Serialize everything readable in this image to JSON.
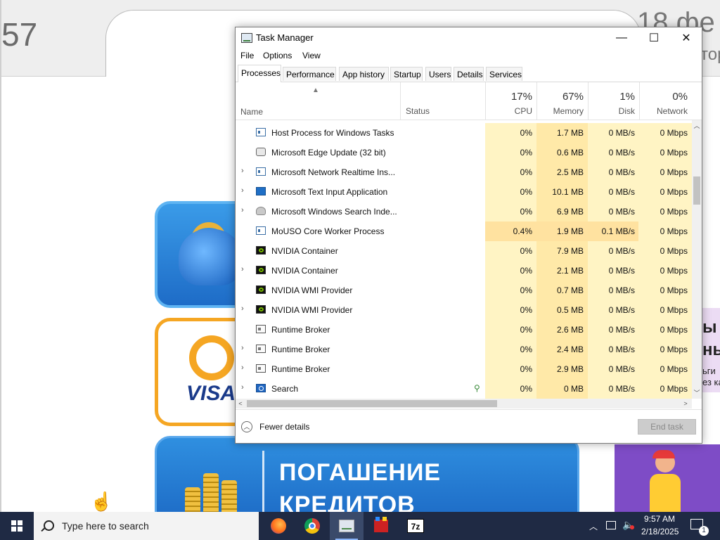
{
  "background_app": {
    "time_fragment": "57",
    "date_fragment": "18 фе",
    "date_sub_fragment": "тор",
    "credit_tile": {
      "line1": "ПОГАШЕНИЕ",
      "line2": "КРЕДИТОВ"
    },
    "qiwi_tile": {
      "card_brand": "VISA"
    },
    "promo": {
      "line1": "ы",
      "line2": "ны",
      "small1": "ьги",
      "small2": "ез ка"
    }
  },
  "window": {
    "title": "Task Manager",
    "controls": {
      "minimize": "—",
      "maximize": "☐",
      "close": "✕"
    },
    "menu": [
      "File",
      "Options",
      "View"
    ],
    "tabs": [
      "Processes",
      "Performance",
      "App history",
      "Startup",
      "Users",
      "Details",
      "Services"
    ],
    "active_tab": "Processes",
    "columns": {
      "name": "Name",
      "status": "Status",
      "cpu": {
        "percent": "17%",
        "label": "CPU"
      },
      "memory": {
        "percent": "67%",
        "label": "Memory"
      },
      "disk": {
        "percent": "1%",
        "label": "Disk"
      },
      "network": {
        "percent": "0%",
        "label": "Network"
      }
    },
    "processes": [
      {
        "name": "Host Process for Windows Tasks",
        "expandable": false,
        "icon": "host-icon",
        "status": "",
        "cpu": "0%",
        "memory": "1.7 MB",
        "disk": "0 MB/s",
        "network": "0 Mbps"
      },
      {
        "name": "Microsoft Edge Update (32 bit)",
        "expandable": false,
        "icon": "edge-update-icon",
        "status": "",
        "cpu": "0%",
        "memory": "0.6 MB",
        "disk": "0 MB/s",
        "network": "0 Mbps"
      },
      {
        "name": "Microsoft Network Realtime Ins...",
        "expandable": true,
        "icon": "host-icon",
        "status": "",
        "cpu": "0%",
        "memory": "2.5 MB",
        "disk": "0 MB/s",
        "network": "0 Mbps"
      },
      {
        "name": "Microsoft Text Input Application",
        "expandable": true,
        "icon": "text-input-icon",
        "status": "",
        "cpu": "0%",
        "memory": "10.1 MB",
        "disk": "0 MB/s",
        "network": "0 Mbps"
      },
      {
        "name": "Microsoft Windows Search Inde...",
        "expandable": true,
        "icon": "search-indexer-icon",
        "status": "",
        "cpu": "0%",
        "memory": "6.9 MB",
        "disk": "0 MB/s",
        "network": "0 Mbps"
      },
      {
        "name": "MoUSO Core Worker Process",
        "expandable": false,
        "icon": "host-icon",
        "status": "",
        "cpu": "0.4%",
        "memory": "1.9 MB",
        "disk": "0.1 MB/s",
        "network": "0 Mbps",
        "highlight": true
      },
      {
        "name": "NVIDIA Container",
        "expandable": false,
        "icon": "nvidia-icon",
        "status": "",
        "cpu": "0%",
        "memory": "7.9 MB",
        "disk": "0 MB/s",
        "network": "0 Mbps"
      },
      {
        "name": "NVIDIA Container",
        "expandable": true,
        "icon": "nvidia-icon",
        "status": "",
        "cpu": "0%",
        "memory": "2.1 MB",
        "disk": "0 MB/s",
        "network": "0 Mbps"
      },
      {
        "name": "NVIDIA WMI Provider",
        "expandable": false,
        "icon": "nvidia-icon",
        "status": "",
        "cpu": "0%",
        "memory": "0.7 MB",
        "disk": "0 MB/s",
        "network": "0 Mbps"
      },
      {
        "name": "NVIDIA WMI Provider",
        "expandable": true,
        "icon": "nvidia-icon",
        "status": "",
        "cpu": "0%",
        "memory": "0.5 MB",
        "disk": "0 MB/s",
        "network": "0 Mbps"
      },
      {
        "name": "Runtime Broker",
        "expandable": false,
        "icon": "broker-icon",
        "status": "",
        "cpu": "0%",
        "memory": "2.6 MB",
        "disk": "0 MB/s",
        "network": "0 Mbps"
      },
      {
        "name": "Runtime Broker",
        "expandable": true,
        "icon": "broker-icon",
        "status": "",
        "cpu": "0%",
        "memory": "2.4 MB",
        "disk": "0 MB/s",
        "network": "0 Mbps"
      },
      {
        "name": "Runtime Broker",
        "expandable": true,
        "icon": "broker-icon",
        "status": "",
        "cpu": "0%",
        "memory": "2.9 MB",
        "disk": "0 MB/s",
        "network": "0 Mbps"
      },
      {
        "name": "Search",
        "expandable": true,
        "icon": "search-app-icon",
        "status": "suspended-leaf",
        "cpu": "0%",
        "memory": "0 MB",
        "disk": "0 MB/s",
        "network": "0 Mbps"
      }
    ],
    "footer": {
      "fewer_details": "Fewer details",
      "end_task": "End task"
    }
  },
  "taskbar": {
    "search_placeholder": "Type here to search",
    "apps": [
      "firefox-icon",
      "chrome-icon",
      "task-manager-icon",
      "red-app-icon",
      "7zip-icon"
    ],
    "active_app": "task-manager-icon",
    "sevenzip_label": "7z",
    "clock": {
      "time": "9:57 AM",
      "date": "2/18/2025"
    },
    "notification_count": "1"
  },
  "colors": {
    "heat_yellow": "#fff4c4",
    "heat_yellow_strong": "#ffe9a8",
    "taskbar": "#1f2a44",
    "accent_orange": "#f5a623",
    "tile_blue": "#2f8fe0"
  }
}
